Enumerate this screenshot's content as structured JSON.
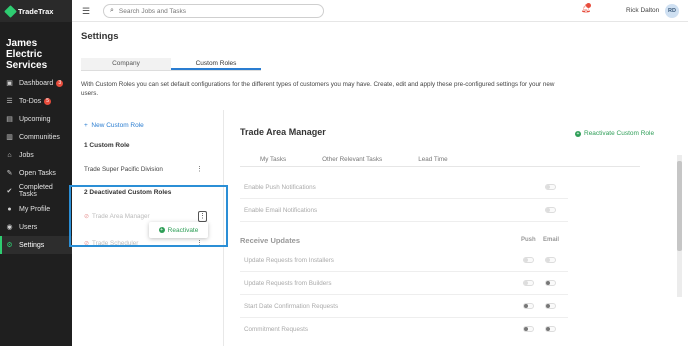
{
  "app": {
    "name": "TradeTrax",
    "company": "James Electric Services"
  },
  "topbar": {
    "search_placeholder": "Search Jobs and Tasks",
    "user_name": "Rick Dalton",
    "user_initials": "RD"
  },
  "sidebar": {
    "items": [
      {
        "label": "Dashboard",
        "icon": "dashboard-icon",
        "badge": "3"
      },
      {
        "label": "To-Dos",
        "icon": "todo-icon",
        "badge": "5"
      },
      {
        "label": "Upcoming",
        "icon": "calendar-icon"
      },
      {
        "label": "Communities",
        "icon": "building-icon"
      },
      {
        "label": "Jobs",
        "icon": "home-icon"
      },
      {
        "label": "Open Tasks",
        "icon": "wrench-icon"
      },
      {
        "label": "Completed Tasks",
        "icon": "check-icon"
      },
      {
        "label": "My Profile",
        "icon": "user-icon"
      },
      {
        "label": "Users",
        "icon": "users-icon"
      },
      {
        "label": "Settings",
        "icon": "gear-icon",
        "active": true
      }
    ]
  },
  "page": {
    "title": "Settings",
    "tabs": [
      {
        "label": "Company"
      },
      {
        "label": "Custom Roles",
        "active": true
      }
    ],
    "description": "With Custom Roles you can set default configurations for the different types of customers you may have. Create, edit and apply these pre-configured settings for your new users."
  },
  "roles": {
    "new_label": "New Custom Role",
    "active_header": "1 Custom Role",
    "active": [
      "Trade Super Pacific Division"
    ],
    "deactivated_header": "2 Deactivated Custom Roles",
    "deactivated": [
      "Trade Area Manager",
      "Trade Scheduler"
    ],
    "popup_label": "Reactivate"
  },
  "detail": {
    "title": "Trade Area Manager",
    "reactivate_label": "Reactivate Custom Role",
    "subtabs": [
      "My Tasks",
      "Other Relevant Tasks",
      "Lead Time"
    ],
    "notifications": [
      "Enable Push Notifications",
      "Enable Email Notifications"
    ],
    "updates_header": "Receive Updates",
    "col_push": "Push",
    "col_email": "Email",
    "updates": [
      "Update Requests from Installers",
      "Update Requests from Builders",
      "Start Date Confirmation Requests",
      "Commitment Requests"
    ]
  },
  "colors": {
    "accent": "#2a7dd1",
    "brand_green": "#2ecc71",
    "highlight": "#2b8fd6",
    "badge": "#e74c3c"
  }
}
